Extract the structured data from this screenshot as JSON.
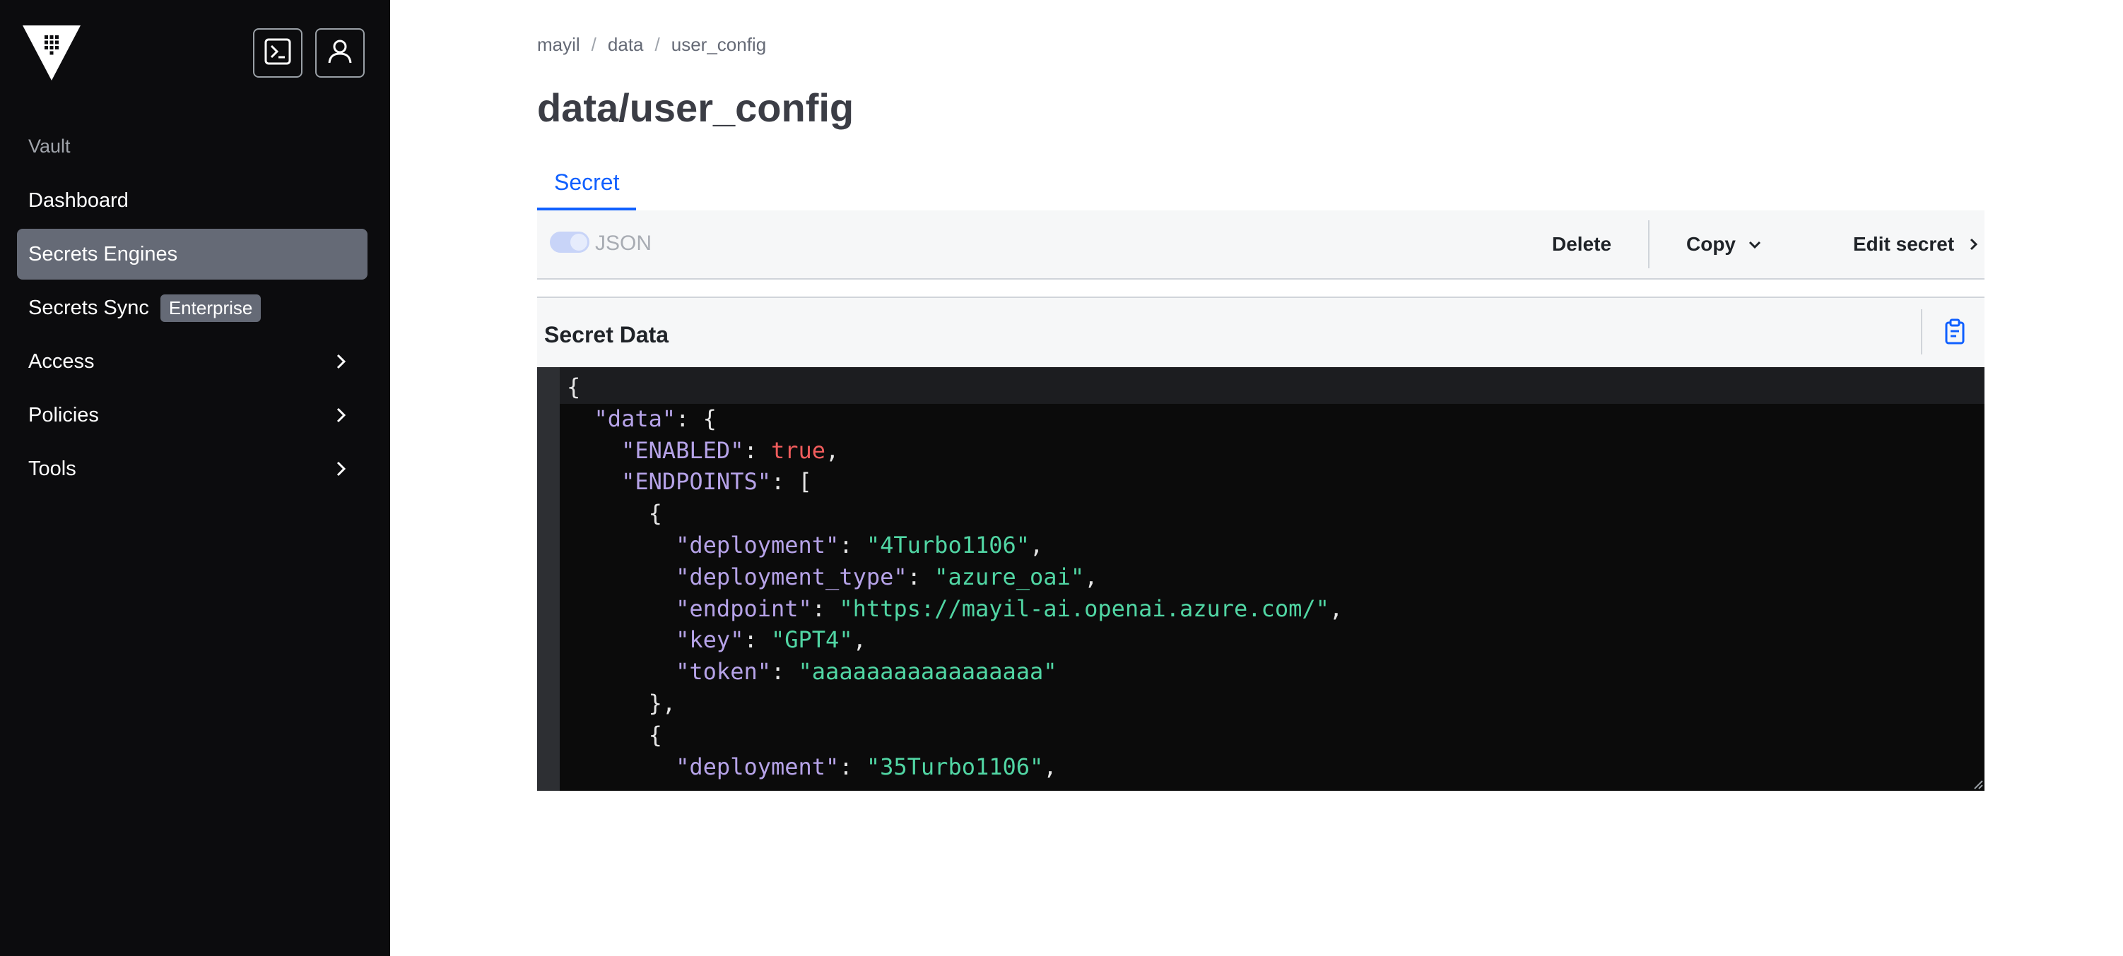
{
  "sidebar": {
    "section_label": "Vault",
    "items": [
      {
        "label": "Dashboard"
      },
      {
        "label": "Secrets Engines",
        "active": true
      },
      {
        "label": "Secrets Sync",
        "badge": "Enterprise"
      },
      {
        "label": "Access",
        "icon": "chevron-right-icon"
      },
      {
        "label": "Policies",
        "icon": "chevron-right-icon"
      },
      {
        "label": "Tools",
        "icon": "chevron-right-icon"
      }
    ],
    "icons": [
      "vault-logo-icon",
      "console-icon",
      "user-icon"
    ]
  },
  "breadcrumb": [
    "mayil",
    "data",
    "user_config"
  ],
  "page": {
    "title": "data/user_config",
    "tab": "Secret"
  },
  "toolbar": {
    "json_toggle_label": "JSON",
    "delete_label": "Delete",
    "copy_label": "Copy",
    "edit_label": "Edit secret"
  },
  "card": {
    "title": "Secret Data",
    "icon": "clipboard-icon"
  },
  "secret_json": {
    "open_brace": "{",
    "data_key": "\"data\"",
    "data_open": ": {",
    "enabled_key": "\"ENABLED\"",
    "enabled_value": "true",
    "endpoints_key": "\"ENDPOINTS\"",
    "endpoints_open": ": [",
    "ep1": {
      "deployment": "\"4Turbo1106\"",
      "deployment_type": "\"azure_oai\"",
      "endpoint": "\"https://mayil-ai.openai.azure.com/\"",
      "key": "\"GPT4\"",
      "token": "\"aaaaaaaaaaaaaaaaa\""
    },
    "ep2": {
      "deployment": "\"35Turbo1106\""
    },
    "keys": {
      "deployment": "\"deployment\"",
      "deployment_type": "\"deployment_type\"",
      "endpoint": "\"endpoint\"",
      "key": "\"key\"",
      "token": "\"token\""
    }
  },
  "colors": {
    "sidebar_bg": "#0c0c0e",
    "active_item": "#656a76",
    "accent": "#1060ff",
    "json_key": "#b6a3e8",
    "json_string": "#51d6a4",
    "json_boolean": "#f05c5c"
  }
}
